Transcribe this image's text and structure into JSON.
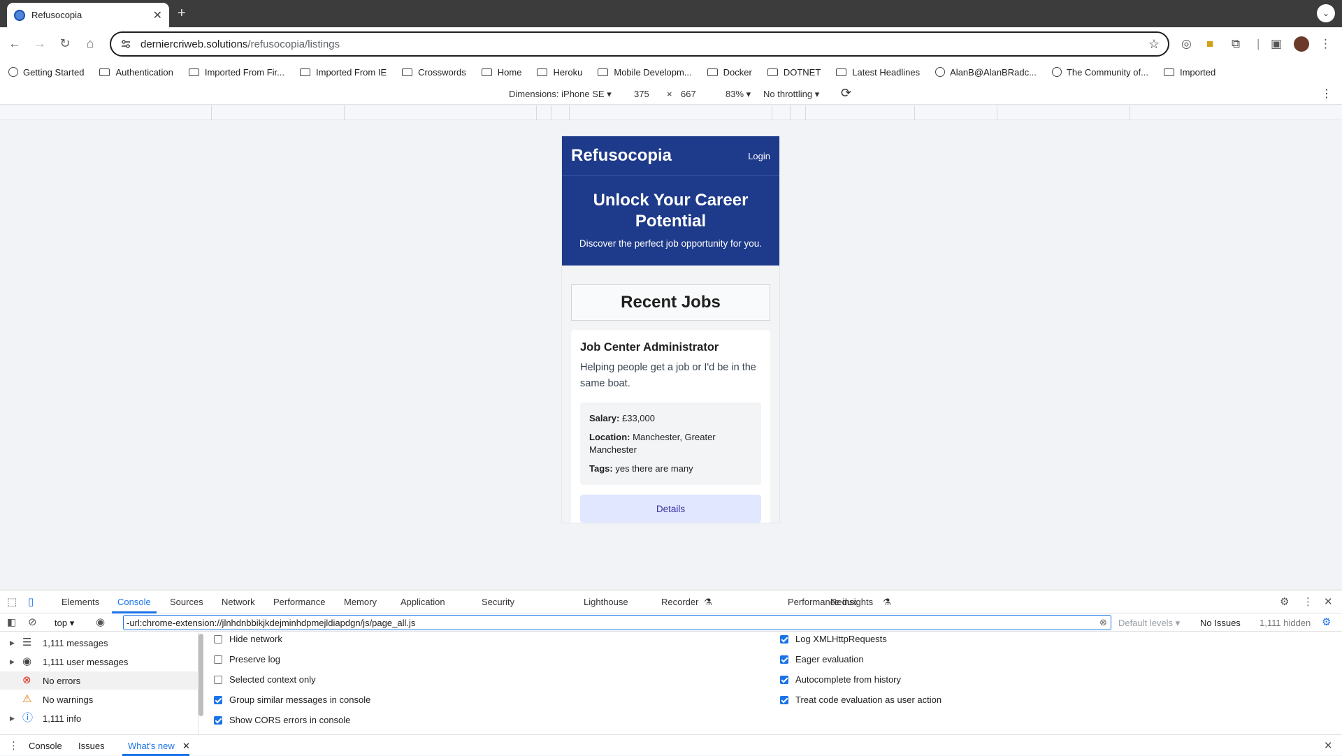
{
  "browser": {
    "tab_title": "Refusocopia",
    "url_host": "derniercriweb.solutions",
    "url_path": "/refusocopia/listings",
    "bookmarks": [
      {
        "label": "Getting Started",
        "icon": "globe-icon"
      },
      {
        "label": "Authentication",
        "icon": "folder-icon"
      },
      {
        "label": "Imported From Fir...",
        "icon": "folder-icon"
      },
      {
        "label": "Imported From IE",
        "icon": "folder-icon"
      },
      {
        "label": "Crosswords",
        "icon": "folder-icon"
      },
      {
        "label": "Home",
        "icon": "folder-icon"
      },
      {
        "label": "Heroku",
        "icon": "folder-icon"
      },
      {
        "label": "Mobile Developm...",
        "icon": "folder-icon"
      },
      {
        "label": "Docker",
        "icon": "folder-icon"
      },
      {
        "label": "DOTNET",
        "icon": "folder-icon"
      },
      {
        "label": "Latest Headlines",
        "icon": "folder-icon"
      },
      {
        "label": "AlanB@AlanBRadc...",
        "icon": "globe-icon"
      },
      {
        "label": "The Community of...",
        "icon": "globe-icon"
      },
      {
        "label": "Imported",
        "icon": "folder-icon"
      }
    ]
  },
  "device_toolbar": {
    "dimensions_label": "Dimensions: iPhone SE",
    "width": "375",
    "times": "×",
    "height": "667",
    "zoom": "83%",
    "throttling": "No throttling"
  },
  "site": {
    "logo": "Refusocopia",
    "login": "Login",
    "hero_title": "Unlock Your Career Potential",
    "hero_subtitle": "Discover the perfect job opportunity for you.",
    "section_title": "Recent Jobs",
    "job": {
      "title": "Job Center Administrator",
      "description": "Helping people get a job or I'd be in the same boat.",
      "salary_label": "Salary:",
      "salary": "£33,000",
      "location_label": "Location:",
      "location": "Manchester, Greater Manchester",
      "tags_label": "Tags:",
      "tags": "yes there are many",
      "details_button": "Details"
    }
  },
  "devtools": {
    "tabs": [
      "Elements",
      "Console",
      "Sources",
      "Network",
      "Performance",
      "Memory",
      "Application",
      "Security",
      "Lighthouse",
      "Recorder",
      "Performance insights",
      "Redux"
    ],
    "active_tab": "Console",
    "context": "top",
    "filter_value": "-url:chrome-extension://jlnhdnbbikjkdejminhdpmejldiapdgn/js/page_all.js",
    "levels": "Default levels",
    "issues": "No Issues",
    "hidden": "1,111 hidden",
    "sidebar": [
      {
        "label": "1,111 messages",
        "icon": "list-icon"
      },
      {
        "label": "1,111 user messages",
        "icon": "user-icon"
      },
      {
        "label": "No errors",
        "icon": "error-icon"
      },
      {
        "label": "No warnings",
        "icon": "warning-icon"
      },
      {
        "label": "1,111 info",
        "icon": "info-icon"
      }
    ],
    "options_left": [
      {
        "label": "Hide network",
        "checked": false
      },
      {
        "label": "Preserve log",
        "checked": false
      },
      {
        "label": "Selected context only",
        "checked": false
      },
      {
        "label": "Group similar messages in console",
        "checked": true
      },
      {
        "label": "Show CORS errors in console",
        "checked": true
      }
    ],
    "options_right": [
      {
        "label": "Log XMLHttpRequests",
        "checked": true
      },
      {
        "label": "Eager evaluation",
        "checked": true
      },
      {
        "label": "Autocomplete from history",
        "checked": true
      },
      {
        "label": "Treat code evaluation as user action",
        "checked": true
      }
    ],
    "drawer_tabs": [
      "Console",
      "Issues",
      "What's new"
    ],
    "drawer_active": "What's new"
  }
}
